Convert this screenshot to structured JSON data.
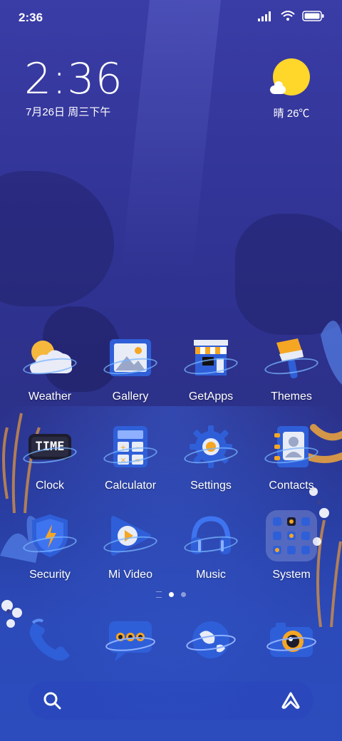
{
  "status_bar": {
    "time": "2:36",
    "icons": [
      "signal-icon",
      "wifi-icon",
      "battery-icon"
    ]
  },
  "clock_widget": {
    "time": "2:36",
    "date": "7月26日 周三下午"
  },
  "weather_widget": {
    "icon": "sunny-cloud-icon",
    "text": "晴 26℃"
  },
  "apps": [
    {
      "label": "Weather",
      "icon": "weather-icon"
    },
    {
      "label": "Gallery",
      "icon": "gallery-icon"
    },
    {
      "label": "GetApps",
      "icon": "getapps-icon"
    },
    {
      "label": "Themes",
      "icon": "themes-icon"
    },
    {
      "label": "Clock",
      "icon": "clock-icon",
      "icon_text": "TIME"
    },
    {
      "label": "Calculator",
      "icon": "calculator-icon"
    },
    {
      "label": "Settings",
      "icon": "settings-icon"
    },
    {
      "label": "Contacts",
      "icon": "contacts-icon"
    },
    {
      "label": "Security",
      "icon": "security-icon"
    },
    {
      "label": "Mi Video",
      "icon": "mi-video-icon"
    },
    {
      "label": "Music",
      "icon": "music-icon"
    },
    {
      "label": "System",
      "icon": "system-folder-icon"
    }
  ],
  "pager": {
    "pages": 2,
    "active": 1
  },
  "dock": [
    {
      "icon": "phone-icon"
    },
    {
      "icon": "messages-icon"
    },
    {
      "icon": "browser-icon"
    },
    {
      "icon": "camera-icon"
    }
  ],
  "search_bar": {
    "left_icon": "search-icon",
    "right_icon": "assistant-icon"
  },
  "colors": {
    "accent_blue": "#2f5fd8",
    "sun_yellow": "#ffd62a",
    "orange": "#f5a623"
  }
}
